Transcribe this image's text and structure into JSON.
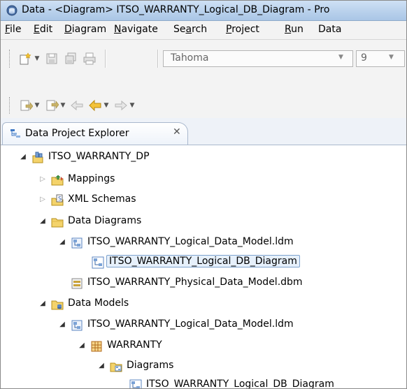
{
  "window": {
    "title": "Data - <Diagram> ITSO_WARRANTY_Logical_DB_Diagram - Pro",
    "app_icon": "eclipse-data-icon"
  },
  "menubar": {
    "items": [
      {
        "label": "File",
        "mnemonic": "F"
      },
      {
        "label": "Edit",
        "mnemonic": "E"
      },
      {
        "label": "Diagram",
        "mnemonic": "D"
      },
      {
        "label": "Navigate",
        "mnemonic": "N"
      },
      {
        "label": "Search",
        "mnemonic": "a"
      },
      {
        "label": "Project",
        "mnemonic": "P"
      },
      {
        "label": "Run",
        "mnemonic": "R"
      },
      {
        "label": "Data",
        "mnemonic": ""
      }
    ]
  },
  "toolbar": {
    "row1_icons": [
      "new-wizard-icon",
      "save-icon",
      "save-all-icon",
      "print-icon"
    ],
    "font": {
      "name": "Tahoma"
    },
    "font_size": {
      "value": "9"
    },
    "row2_icons": [
      "next-annotation-icon",
      "previous-annotation-icon",
      "last-edit-location-icon",
      "back-icon",
      "forward-icon"
    ]
  },
  "view": {
    "tab_label": "Data Project Explorer",
    "tab_close": "✕",
    "tab_icon": "data-project-explorer-icon"
  },
  "tree": {
    "rows": [
      {
        "label": "ITSO_WARRANTY_DP",
        "icon": "data-design-project-icon",
        "expanded": true,
        "selected": false
      },
      {
        "label": "Mappings",
        "icon": "mappings-folder-icon",
        "expanded": false,
        "selected": false
      },
      {
        "label": "XML Schemas",
        "icon": "xml-schemas-folder-icon",
        "expanded": false,
        "selected": false
      },
      {
        "label": "Data Diagrams",
        "icon": "folder-icon",
        "expanded": true,
        "selected": false
      },
      {
        "label": "ITSO_WARRANTY_Logical_Data_Model.ldm",
        "icon": "logical-model-icon",
        "expanded": true,
        "selected": false
      },
      {
        "label": "ITSO_WARRANTY_Logical_DB_Diagram",
        "icon": "diagram-icon",
        "expanded": null,
        "selected": true
      },
      {
        "label": "ITSO_WARRANTY_Physical_Data_Model.dbm",
        "icon": "physical-model-icon",
        "expanded": null,
        "selected": false
      },
      {
        "label": "Data Models",
        "icon": "data-models-folder-icon",
        "expanded": true,
        "selected": false
      },
      {
        "label": "ITSO_WARRANTY_Logical_Data_Model.ldm",
        "icon": "logical-model-icon",
        "expanded": true,
        "selected": false
      },
      {
        "label": "WARRANTY",
        "icon": "package-icon",
        "expanded": true,
        "selected": false
      },
      {
        "label": "Diagrams",
        "icon": "diagrams-folder-icon",
        "expanded": true,
        "selected": false
      },
      {
        "label": "ITSO_WARRANTY_Logical_DB_Diagram",
        "icon": "diagram-icon",
        "expanded": null,
        "selected": false
      }
    ]
  },
  "colors": {
    "titlebar": "#b9d1ec",
    "selection_fill": "#e6f0fb",
    "selection_border": "#7da2ce",
    "folder_yellow": "#f4d36b"
  }
}
